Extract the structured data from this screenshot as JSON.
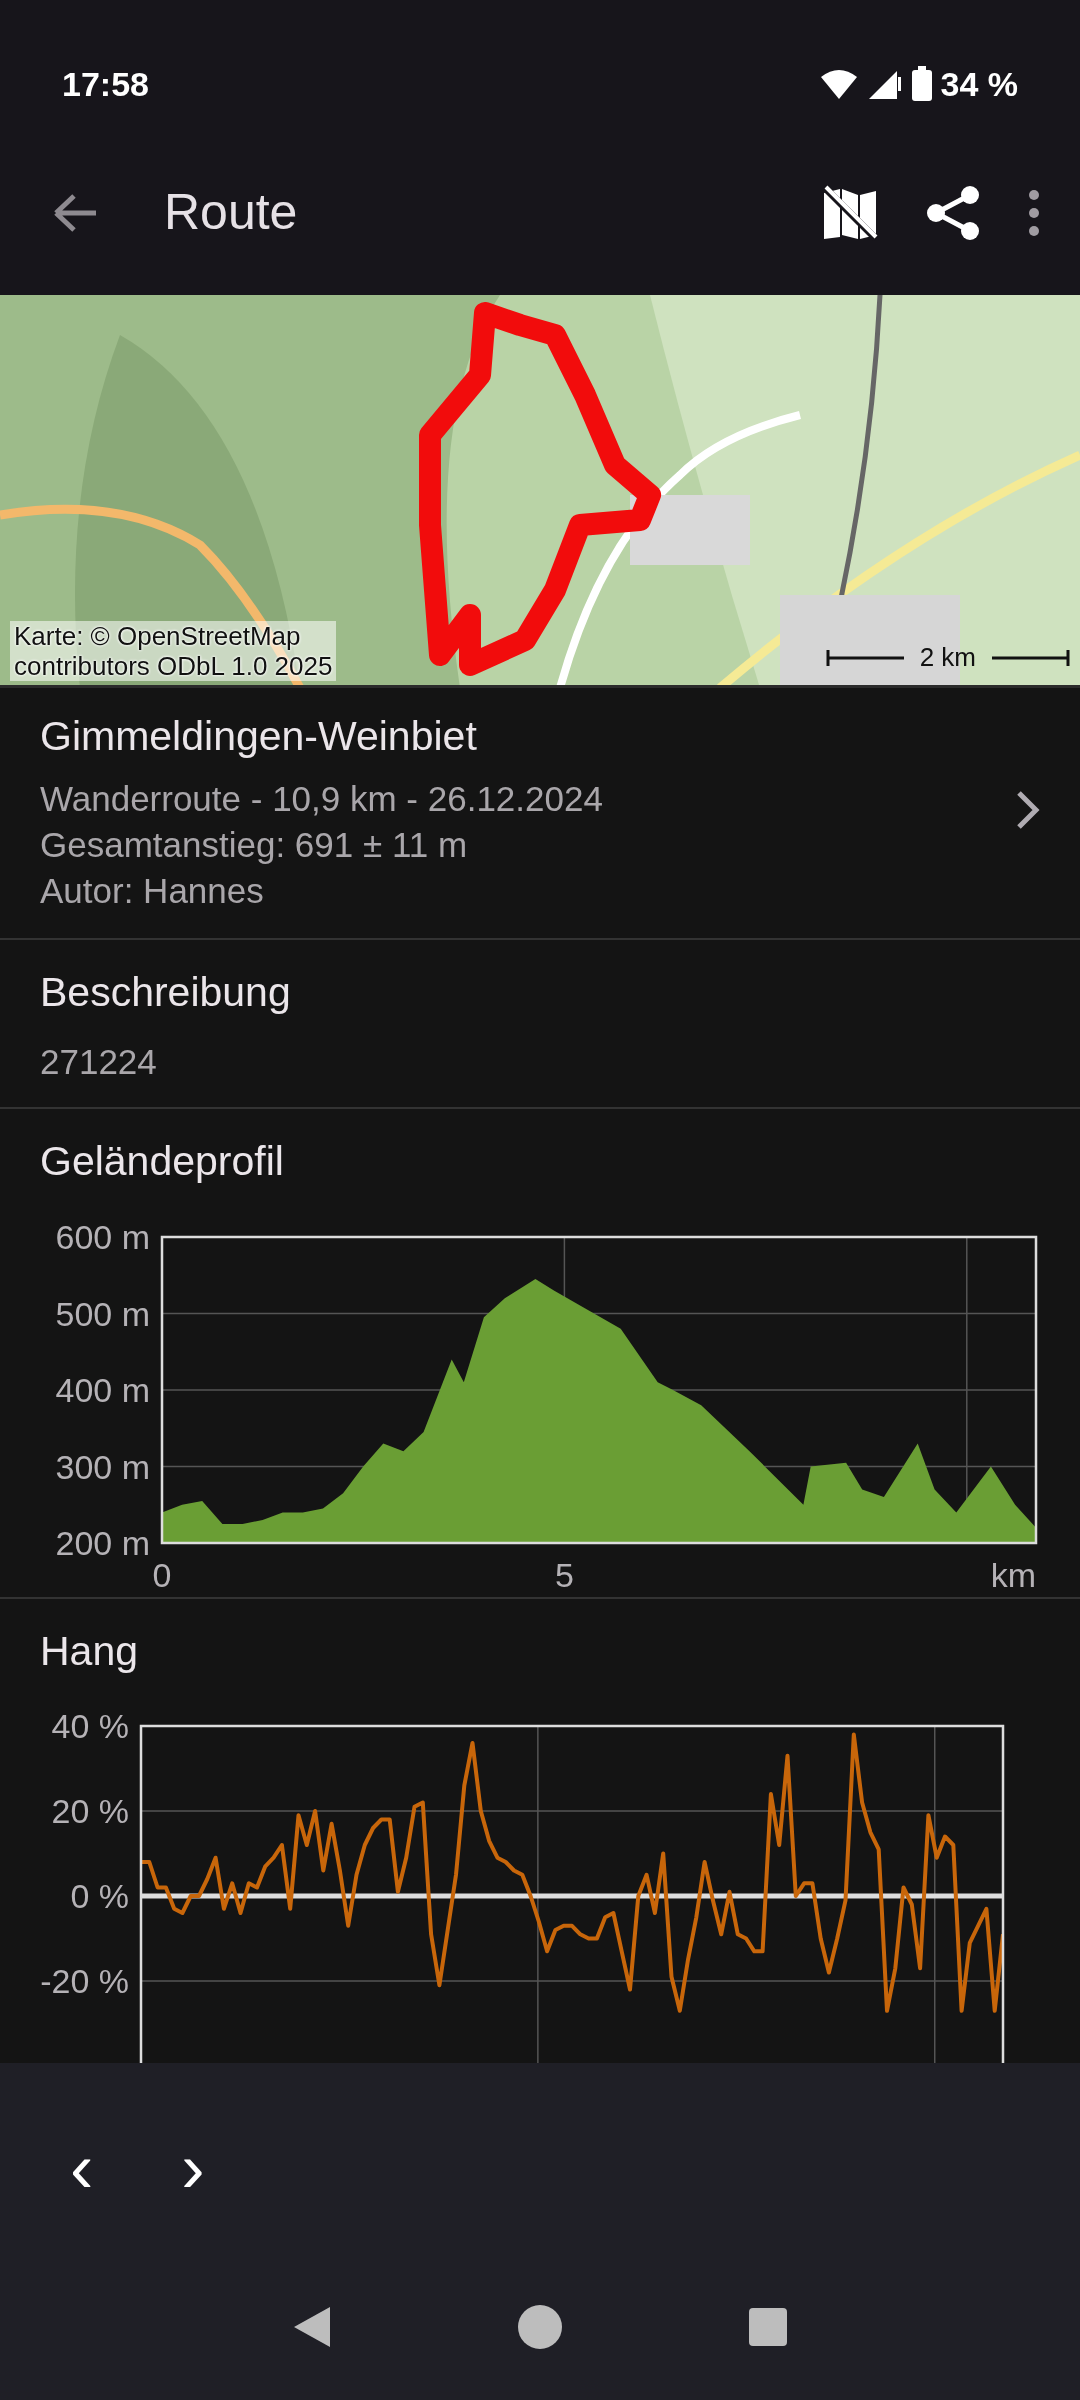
{
  "status_bar": {
    "time": "17:58",
    "battery": "34 %"
  },
  "toolbar": {
    "title": "Route"
  },
  "map": {
    "kind": "picture",
    "attribution": "Karte: © OpenStreetMap\ncontributors ODbL 1.0 2025",
    "scale": "2 km"
  },
  "route": {
    "name": "Gimmeldingen-Weinbiet",
    "lines": [
      "Wanderroute - 10,9 km - 26.12.2024",
      "Gesamtanstieg: 691 ± 11 m",
      "Autor: Hannes"
    ]
  },
  "description": {
    "heading": "Beschreibung",
    "text": "271224"
  },
  "elevation": {
    "heading": "Geländeprofil",
    "chart_data": {
      "type": "area",
      "grid": true,
      "xlabel": "km",
      "xlim": [
        0,
        10.86
      ],
      "ylim": [
        200,
        600
      ],
      "xticks": [
        {
          "value": 0,
          "label": "0"
        },
        {
          "value": 5,
          "label": "5"
        }
      ],
      "yticks": [
        {
          "value": 600,
          "label": "600 m"
        },
        {
          "value": 500,
          "label": "500 m"
        },
        {
          "value": 400,
          "label": "400 m"
        },
        {
          "value": 300,
          "label": "300 m"
        },
        {
          "value": 200,
          "label": "200 m"
        }
      ],
      "x": [
        0,
        0.25,
        0.5,
        0.75,
        1.0,
        1.25,
        1.5,
        1.75,
        2.0,
        2.25,
        2.5,
        2.75,
        3.0,
        3.25,
        3.6,
        3.75,
        4.0,
        4.26,
        4.64,
        4.87,
        5.2,
        5.7,
        6.16,
        6.35,
        6.7,
        7.3,
        7.97,
        8.06,
        8.5,
        8.7,
        8.97,
        9.39,
        9.6,
        9.87,
        10.3,
        10.6,
        10.86
      ],
      "series": [
        {
          "color": "#6a9e34",
          "values": [
            240,
            250,
            255,
            225,
            225,
            230,
            240,
            240,
            245,
            265,
            300,
            330,
            320,
            345,
            440,
            410,
            495,
            520,
            545,
            530,
            510,
            480,
            410,
            400,
            380,
            320,
            250,
            300,
            305,
            270,
            260,
            330,
            270,
            240,
            300,
            250,
            220
          ]
        }
      ]
    }
  },
  "slope": {
    "heading": "Hang",
    "chart_data": {
      "type": "line",
      "grid": true,
      "ylim": [
        -40,
        40
      ],
      "yticks": [
        {
          "value": 40,
          "label": "40 %"
        },
        {
          "value": 20,
          "label": "20 %"
        },
        {
          "value": 0,
          "label": "0 %"
        },
        {
          "value": -20,
          "label": "-20 %"
        }
      ],
      "categories": [
        null,
        null,
        null,
        null,
        null,
        null,
        null,
        null,
        null,
        null,
        null,
        null,
        null,
        null,
        null,
        null,
        null,
        null,
        null,
        null,
        null,
        null,
        null,
        null,
        null,
        null,
        null,
        null,
        null,
        null,
        null,
        null,
        null,
        null,
        null,
        null,
        null,
        null,
        null,
        null,
        null,
        null,
        null,
        null,
        null,
        null,
        null,
        null,
        null,
        null,
        null,
        null,
        null,
        null,
        null,
        null,
        null,
        null,
        null,
        null,
        null,
        null,
        null,
        null,
        null,
        null,
        null,
        null,
        null,
        null,
        null,
        null,
        null,
        null,
        null,
        null,
        null,
        null,
        null,
        null,
        null,
        null,
        null,
        null,
        null,
        null,
        null,
        null,
        null,
        null,
        null,
        null,
        null,
        null,
        null,
        null,
        null,
        null,
        null,
        null,
        null,
        null,
        null,
        null,
        null
      ],
      "series": [
        {
          "color": "#c8660a",
          "values": [
            8,
            8,
            2,
            2,
            -3,
            -4,
            0,
            0,
            4,
            9,
            -3,
            3,
            -4,
            3,
            2,
            7,
            9,
            12,
            -3,
            19,
            12,
            20,
            6,
            17,
            6,
            -7,
            5,
            12,
            16,
            18,
            18,
            1,
            9,
            21,
            22,
            -9,
            -21,
            -8,
            5,
            26,
            36,
            20,
            13,
            9,
            8,
            6,
            5,
            0,
            -6,
            -13,
            -8,
            -7,
            -7,
            -9,
            -10,
            -10,
            -5,
            -4,
            -13,
            -22,
            0,
            5,
            -4,
            10,
            -19,
            -27,
            -15,
            -5,
            8,
            -1,
            -9,
            1,
            -9,
            -10,
            -13,
            -13,
            24,
            12,
            33,
            0,
            3,
            3,
            -10,
            -18,
            -10,
            -1,
            38,
            22,
            15,
            11,
            -27,
            -17,
            2,
            -2,
            -17,
            19,
            9,
            14,
            12,
            -27,
            -11,
            -7,
            -3,
            -27,
            -9
          ]
        }
      ]
    }
  },
  "bottom_bar": {
    "prev": "‹",
    "next": "›"
  }
}
